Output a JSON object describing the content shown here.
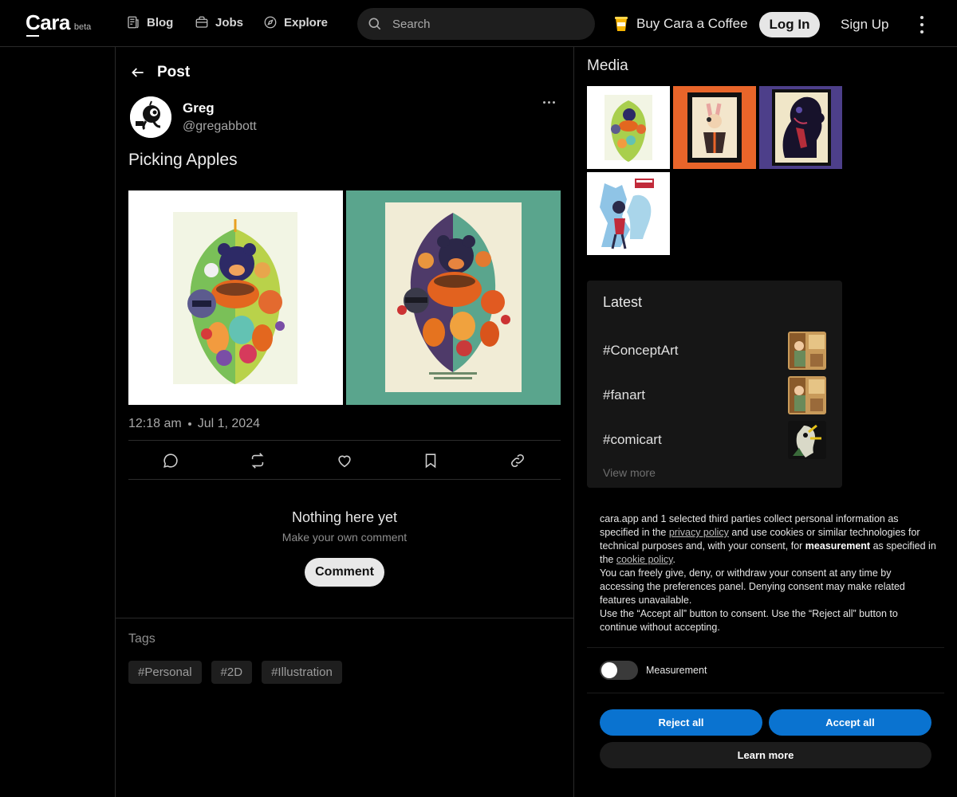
{
  "nav": {
    "logo": "Cara",
    "logo_badge": "beta",
    "links": [
      {
        "label": "Blog",
        "icon": "newspaper-icon"
      },
      {
        "label": "Jobs",
        "icon": "briefcase-icon"
      },
      {
        "label": "Explore",
        "icon": "compass-icon"
      }
    ],
    "search_placeholder": "Search",
    "coffee_label": "Buy Cara a Coffee",
    "login_label": "Log In",
    "signup_label": "Sign Up"
  },
  "post": {
    "header": "Post",
    "author_name": "Greg",
    "author_handle": "@gregabbott",
    "title": "Picking Apples",
    "time": "12:18 am",
    "date": "Jul 1, 2024",
    "empty_title": "Nothing here yet",
    "empty_sub": "Make your own comment",
    "comment_label": "Comment",
    "tags_label": "Tags",
    "tags": [
      "#Personal",
      "#2D",
      "#Illustration"
    ]
  },
  "sidebar": {
    "media_label": "Media",
    "latest_title": "Latest",
    "trends": [
      "#ConceptArt",
      "#fanart",
      "#comicart"
    ],
    "view_more": "View more"
  },
  "cookie": {
    "p1_a": "cara.app and 1 selected third parties collect personal information as specified in the ",
    "p1_link1": "privacy policy",
    "p1_b": " and use cookies or similar technologies for technical purposes and, with your consent, for ",
    "p1_bold": "measurement",
    "p1_c": " as specified in the ",
    "p1_link2": "cookie policy",
    "p1_d": ".",
    "p2": "You can freely give, deny, or withdraw your consent at any time by accessing the preferences panel. Denying consent may make related features unavailable.",
    "p3": "Use the “Accept all” button to consent. Use the “Reject all” button to continue without accepting.",
    "toggle_label": "Measurement",
    "reject_label": "Reject all",
    "accept_label": "Accept all",
    "learn_label": "Learn more"
  },
  "colors": {
    "accent_blue": "#0a73d0",
    "background": "#000000",
    "panel": "#161616"
  }
}
